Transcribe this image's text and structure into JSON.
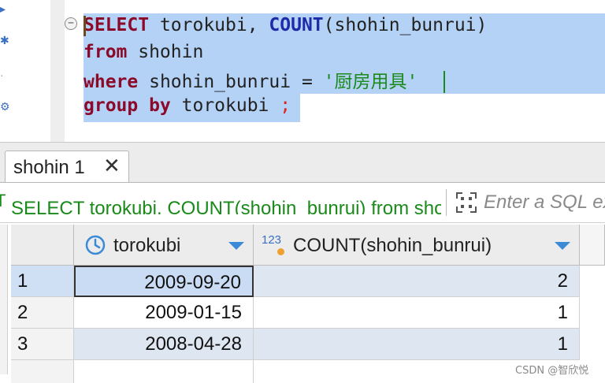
{
  "editor": {
    "fold_symbol": "−",
    "line1": {
      "kw1": "SELECT",
      "text1": " torokubi, ",
      "fn": "COUNT",
      "text2": "(shohin_bunrui)"
    },
    "line2": {
      "kw": "from",
      "text": " shohin"
    },
    "line3": {
      "kw": "where",
      "text": " shohin_bunrui = ",
      "str": "'厨房用具'"
    },
    "line4": {
      "kw": "group by",
      "text": " torokubi ",
      "semi": ";"
    }
  },
  "results": {
    "tab": {
      "label": "shohin 1",
      "close_symbol": "✕"
    },
    "query_bar": {
      "icon_symbol": "T",
      "query_text": "SELECT torokubi, COUNT(shohin_bunrui) from shohin where shohin_bunrui = '厨房用具' group by torokubi",
      "filter_placeholder": "Enter a SQL expression to filter results"
    },
    "grid": {
      "columns": [
        {
          "label": "torokubi",
          "icon": "clock-icon"
        },
        {
          "label": "COUNT(shohin_bunrui)",
          "icon": "numeric-123-icon",
          "icon_text": "123"
        }
      ],
      "rows": [
        {
          "num": "1",
          "torokubi": "2009-09-20",
          "count": "2"
        },
        {
          "num": "2",
          "torokubi": "2009-01-15",
          "count": "1"
        },
        {
          "num": "3",
          "torokubi": "2008-04-28",
          "count": "1"
        }
      ]
    }
  },
  "watermark": "CSDN @智欣悦",
  "colors": {
    "keyword": "#8b0a2a",
    "function": "#1e2aa8",
    "string": "#1a8a1a",
    "selection": "#b4d2f5",
    "accent": "#3b8ad8"
  }
}
